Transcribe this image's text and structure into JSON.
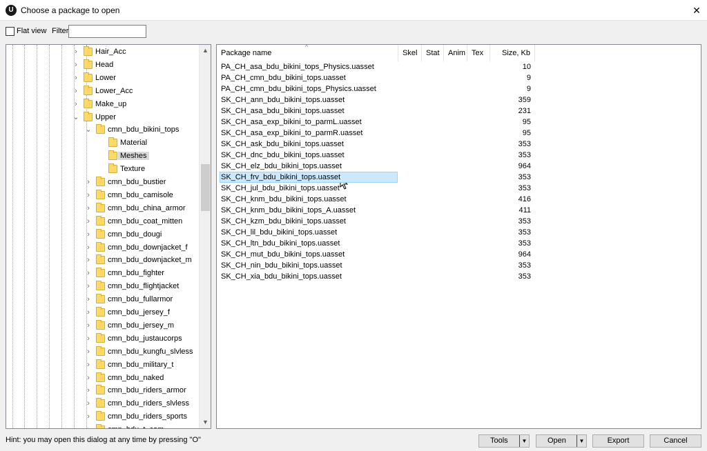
{
  "window": {
    "title": "Choose a package to open",
    "app_icon_glyph": "U",
    "close_glyph": "✕"
  },
  "toolbar": {
    "flat_view_label": "Flat view",
    "flat_view_checked": false,
    "filter_label": "Filter:",
    "filter_value": ""
  },
  "tree": {
    "items": [
      {
        "label": "Hair_Acc",
        "expanded": false
      },
      {
        "label": "Head",
        "expanded": false
      },
      {
        "label": "Lower",
        "expanded": false
      },
      {
        "label": "Lower_Acc",
        "expanded": false
      },
      {
        "label": "Make_up",
        "expanded": false
      },
      {
        "label": "Upper",
        "expanded": true
      },
      {
        "label": "cmn_bdu_bikini_tops",
        "expanded": true
      },
      {
        "label": "Material"
      },
      {
        "label": "Meshes",
        "selected": true
      },
      {
        "label": "Texture"
      },
      {
        "label": "cmn_bdu_bustier",
        "expanded": false
      },
      {
        "label": "cmn_bdu_camisole",
        "expanded": false
      },
      {
        "label": "cmn_bdu_china_armor",
        "expanded": false
      },
      {
        "label": "cmn_bdu_coat_mitten",
        "expanded": false
      },
      {
        "label": "cmn_bdu_dougi",
        "expanded": false
      },
      {
        "label": "cmn_bdu_downjacket_f",
        "expanded": false
      },
      {
        "label": "cmn_bdu_downjacket_m",
        "expanded": false
      },
      {
        "label": "cmn_bdu_fighter",
        "expanded": false
      },
      {
        "label": "cmn_bdu_flightjacket",
        "expanded": false
      },
      {
        "label": "cmn_bdu_fullarmor",
        "expanded": false
      },
      {
        "label": "cmn_bdu_jersey_f",
        "expanded": false
      },
      {
        "label": "cmn_bdu_jersey_m",
        "expanded": false
      },
      {
        "label": "cmn_bdu_justaucorps",
        "expanded": false
      },
      {
        "label": "cmn_bdu_kungfu_slvless",
        "expanded": false
      },
      {
        "label": "cmn_bdu_military_t",
        "expanded": false
      },
      {
        "label": "cmn_bdu_naked",
        "expanded": false
      },
      {
        "label": "cmn_bdu_riders_armor",
        "expanded": false
      },
      {
        "label": "cmn_bdu_riders_slvless",
        "expanded": false
      },
      {
        "label": "cmn_bdu_riders_sports",
        "expanded": false
      },
      {
        "label": "cmn_bdu_t_com",
        "expanded": false
      }
    ]
  },
  "list": {
    "columns": [
      "Package name",
      "Skel",
      "Stat",
      "Anim",
      "Tex",
      "Size, Kb"
    ],
    "rows": [
      {
        "name": "PA_CH_asa_bdu_bikini_tops_Physics.uasset",
        "size": "10"
      },
      {
        "name": "PA_CH_cmn_bdu_bikini_tops.uasset",
        "size": "9"
      },
      {
        "name": "PA_CH_cmn_bdu_bikini_tops_Physics.uasset",
        "size": "9"
      },
      {
        "name": "SK_CH_ann_bdu_bikini_tops.uasset",
        "size": "359"
      },
      {
        "name": "SK_CH_asa_bdu_bikini_tops.uasset",
        "size": "231"
      },
      {
        "name": "SK_CH_asa_exp_bikini_to_parmL.uasset",
        "size": "95"
      },
      {
        "name": "SK_CH_asa_exp_bikini_to_parmR.uasset",
        "size": "95"
      },
      {
        "name": "SK_CH_ask_bdu_bikini_tops.uasset",
        "size": "353"
      },
      {
        "name": "SK_CH_dnc_bdu_bikini_tops.uasset",
        "size": "353"
      },
      {
        "name": "SK_CH_elz_bdu_bikini_tops.uasset",
        "size": "964"
      },
      {
        "name": "SK_CH_frv_bdu_bikini_tops.uasset",
        "size": "353",
        "selected": true
      },
      {
        "name": "SK_CH_jul_bdu_bikini_tops.uasset",
        "size": "353"
      },
      {
        "name": "SK_CH_knm_bdu_bikini_tops.uasset",
        "size": "416"
      },
      {
        "name": "SK_CH_knm_bdu_bikini_tops_A.uasset",
        "size": "411"
      },
      {
        "name": "SK_CH_kzm_bdu_bikini_tops.uasset",
        "size": "353"
      },
      {
        "name": "SK_CH_lil_bdu_bikini_tops.uasset",
        "size": "353"
      },
      {
        "name": "SK_CH_ltn_bdu_bikini_tops.uasset",
        "size": "353"
      },
      {
        "name": "SK_CH_mut_bdu_bikini_tops.uasset",
        "size": "964"
      },
      {
        "name": "SK_CH_nin_bdu_bikini_tops.uasset",
        "size": "353"
      },
      {
        "name": "SK_CH_xia_bdu_bikini_tops.uasset",
        "size": "353"
      }
    ]
  },
  "status": {
    "hint": "Hint: you may open this dialog at any time by pressing \"O\""
  },
  "buttons": {
    "tools": "Tools",
    "open": "Open",
    "export": "Export",
    "cancel": "Cancel"
  },
  "colors": {
    "selection": "#cce8ff",
    "folder": "#ffd966"
  }
}
